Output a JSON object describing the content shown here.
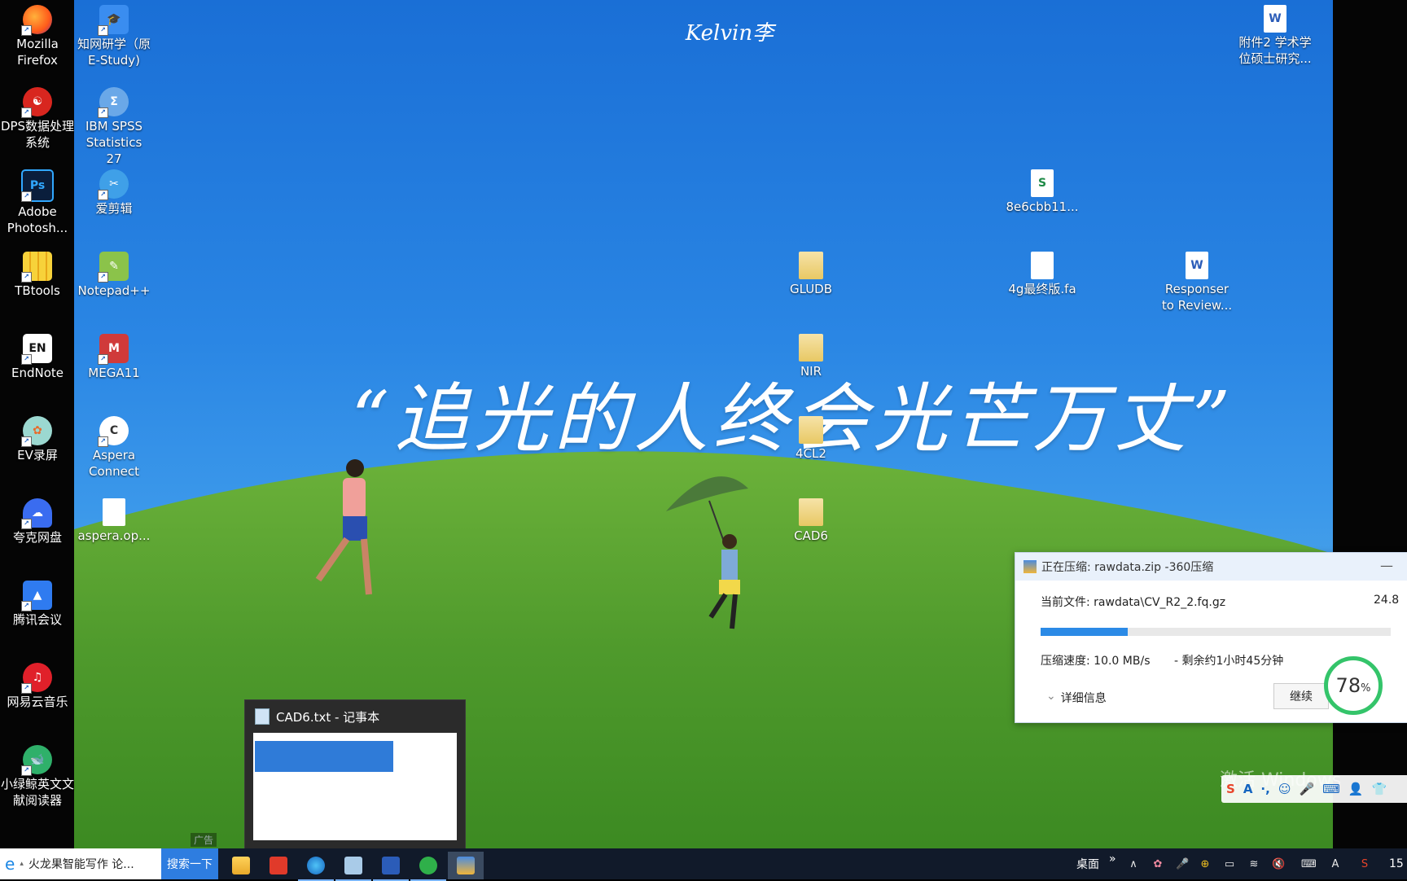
{
  "wallpaper": {
    "logo": "Kelvin李",
    "slogan": "“追光的人终会光芒万丈”"
  },
  "desktop_icons_left": [
    {
      "label": "Mozilla Firefox",
      "icon": "firefox-icon",
      "color": "#ff7a1a"
    },
    {
      "label": "DPS数据处理系统",
      "icon": "dps-icon",
      "color": "#d8261f"
    },
    {
      "label": "Adobe Photosh...",
      "icon": "photoshop-icon",
      "color": "#0a1e3c"
    },
    {
      "label": "TBtools",
      "icon": "tbtools-icon",
      "color": "#f0c020"
    },
    {
      "label": "EndNote",
      "icon": "endnote-icon",
      "color": "#ffffff"
    },
    {
      "label": "EV录屏",
      "icon": "ev-recorder-icon",
      "color": "#9bd8d0"
    },
    {
      "label": "夸克网盘",
      "icon": "quark-drive-icon",
      "color": "#3a6cf0"
    },
    {
      "label": "腾讯会议",
      "icon": "tencent-meeting-icon",
      "color": "#2f7bf0"
    },
    {
      "label": "网易云音乐",
      "icon": "netease-music-icon",
      "color": "#e0202a"
    },
    {
      "label": "小绿鲸英文文献阅读器",
      "icon": "green-whale-icon",
      "color": "#2fb06a"
    }
  ],
  "desktop_icons_col2": [
    {
      "label": "知网研学（原E-Study)",
      "icon": "cnki-icon",
      "color": "#3a8df0"
    },
    {
      "label": "IBM SPSS Statistics 27",
      "icon": "spss-icon",
      "color": "#6aa8e8"
    },
    {
      "label": "爱剪辑",
      "icon": "ijianji-icon",
      "color": "#3fa0e8"
    },
    {
      "label": "Notepad++",
      "icon": "notepadpp-icon",
      "color": "#8bc34a"
    },
    {
      "label": "MEGA11",
      "icon": "mega-icon",
      "color": "#d03a3a"
    },
    {
      "label": "Aspera Connect",
      "icon": "aspera-icon",
      "color": "#ffffff"
    },
    {
      "label": "aspera.op...",
      "icon": "file-icon",
      "color": "#ffffff"
    }
  ],
  "desktop_icons_other": [
    {
      "label": "GLUDB",
      "icon": "folder-zip-icon"
    },
    {
      "label": "NIR",
      "icon": "folder-zip-icon"
    },
    {
      "label": "4CL2",
      "icon": "folder-zip-icon"
    },
    {
      "label": "CAD6",
      "icon": "folder-zip-icon"
    },
    {
      "label": "8e6cbb11...",
      "icon": "excel-file-icon"
    },
    {
      "label": "4g最终版.fa",
      "icon": "file-icon"
    },
    {
      "label": "Responser to Review...",
      "icon": "word-file-icon"
    },
    {
      "label": "附件2 学术学位硕士研究...",
      "icon": "word-file-icon"
    }
  ],
  "compress_dialog": {
    "title": "正在压缩: rawdata.zip -360压缩",
    "current_file_label": "当前文件: rawdata\\CV_R2_2.fq.gz",
    "percent_text": "24.8",
    "progress": 0.248,
    "speed": "压缩速度: 10.0 MB/s",
    "remaining": "- 剩余约1小时45分钟",
    "details": "详细信息",
    "continue_button": "继续",
    "minimize": "—",
    "close": "×"
  },
  "perf_ring": {
    "value": "78",
    "unit": "%"
  },
  "notepad_preview": {
    "title": "CAD6.txt - 记事本"
  },
  "ad_label": "广告",
  "sogou_watermark": "激活 Windows",
  "taskbar": {
    "search_text": "火龙果智能写作  论...",
    "search_button": "搜索一下",
    "desktop_label": "桌面",
    "overflow": "»",
    "clock": "15",
    "ime": "A"
  },
  "accent_colors": {
    "taskbar": "#111a2a",
    "progress": "#2b8ae6",
    "ring": "#34c46a"
  }
}
